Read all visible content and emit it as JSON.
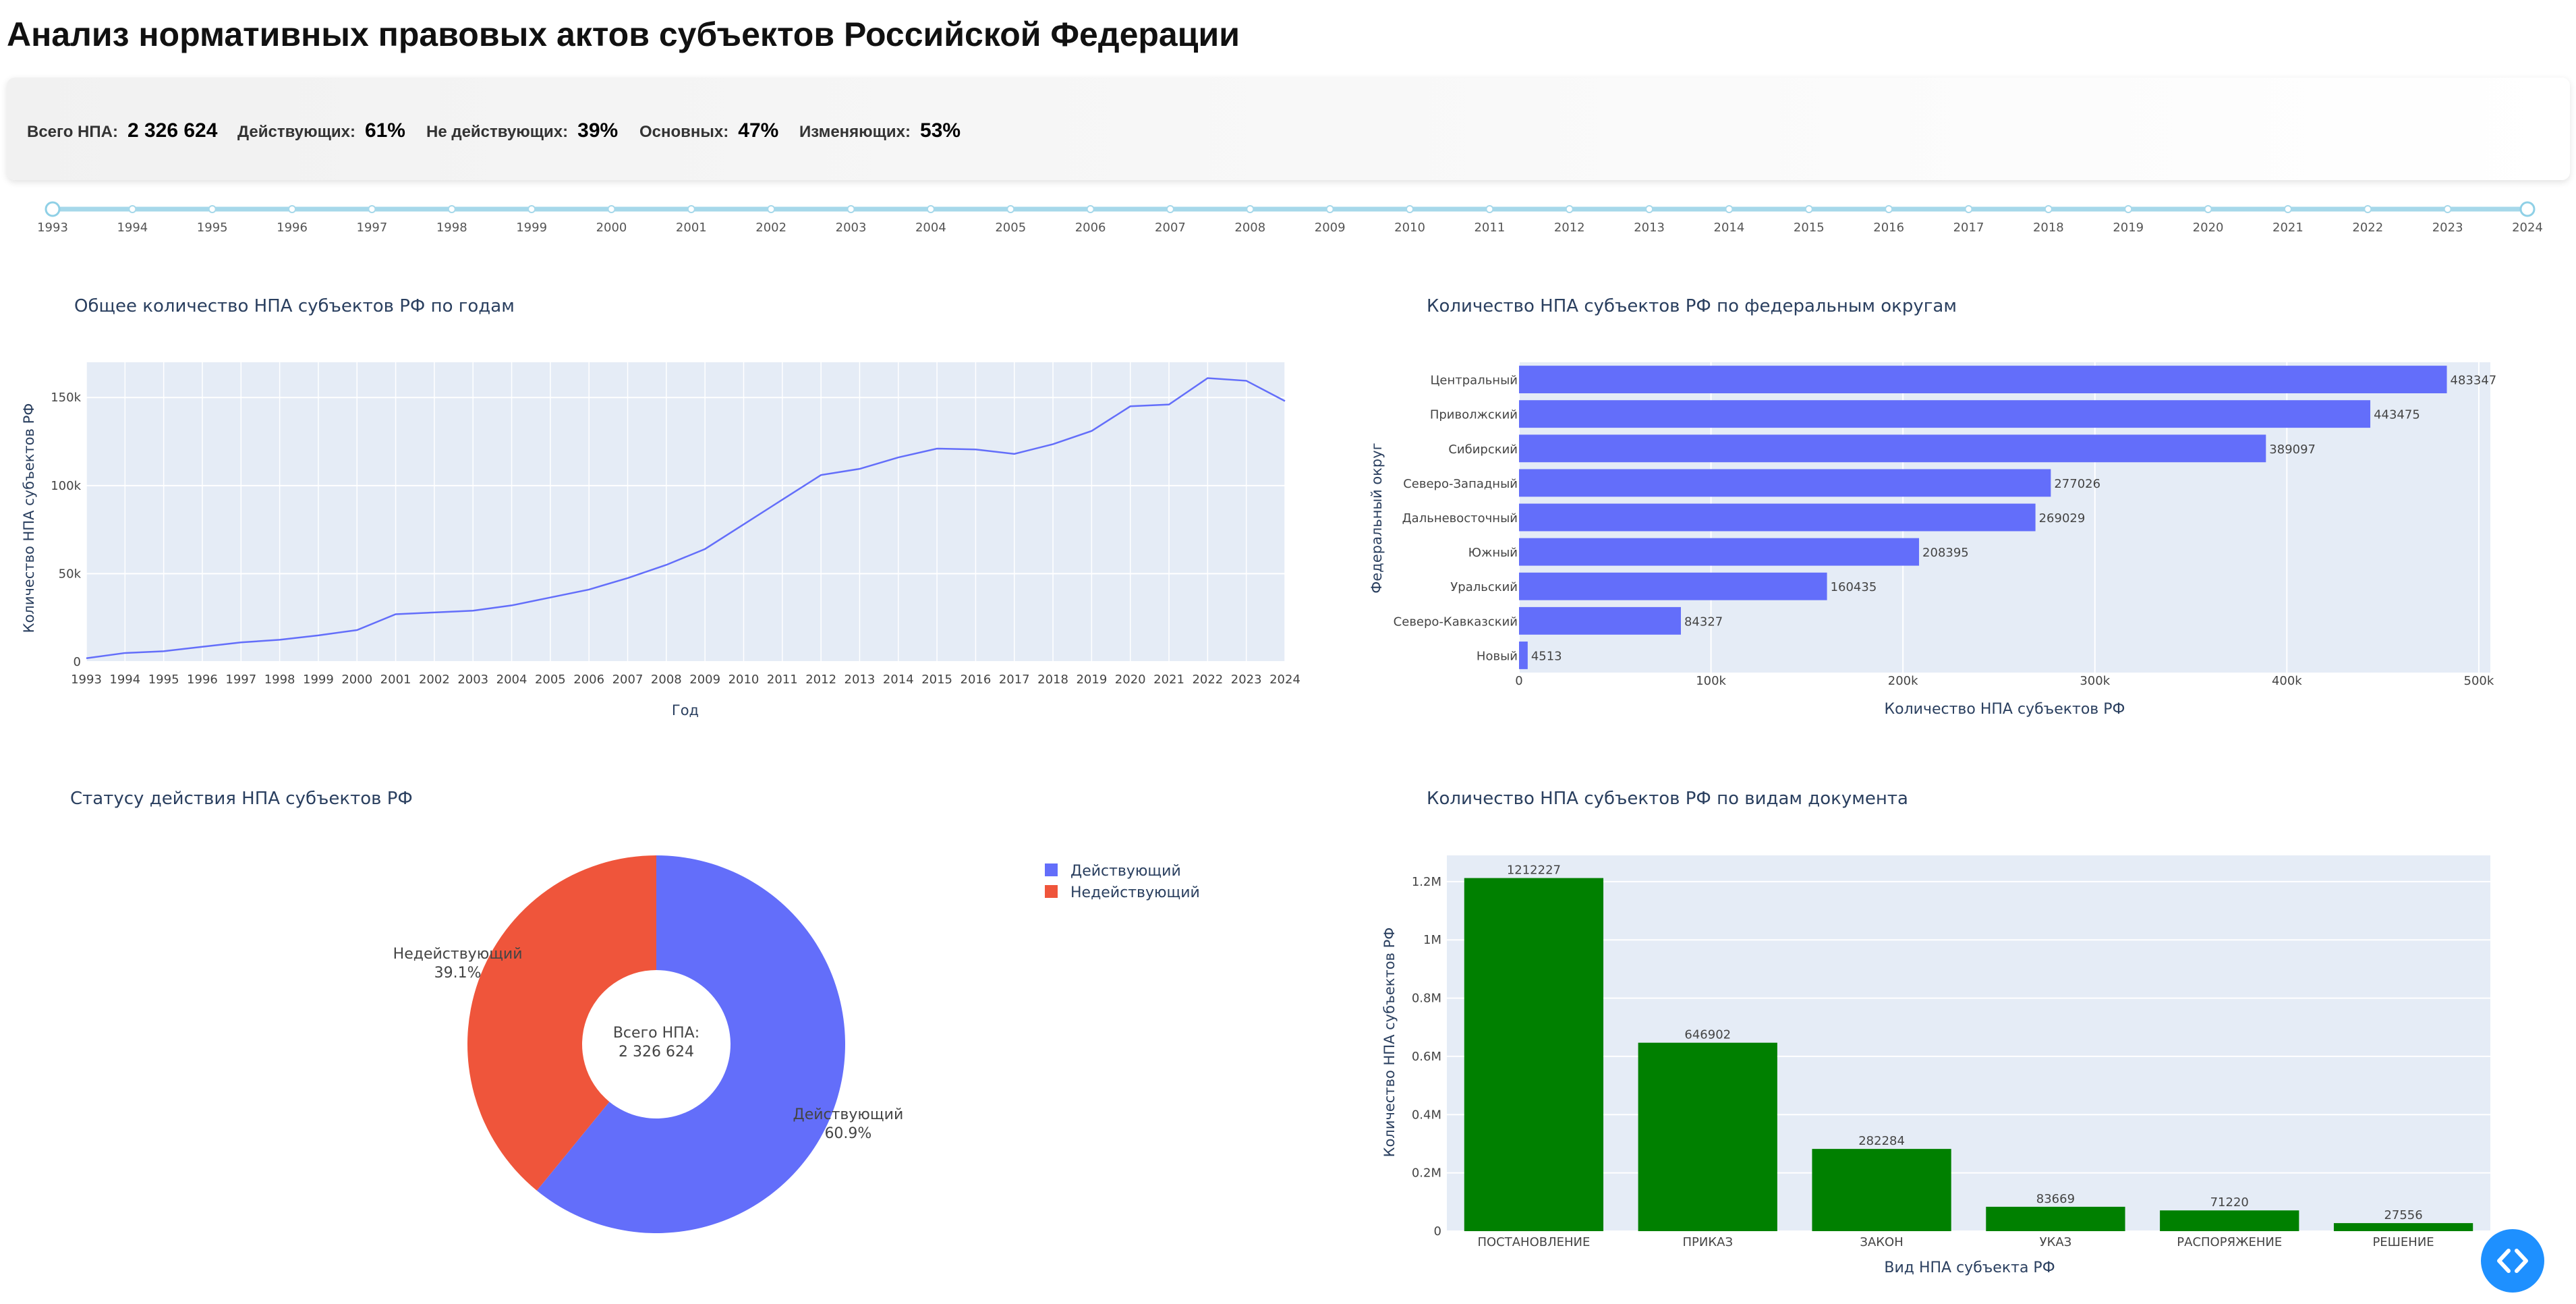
{
  "page": {
    "title": "Анализ нормативных правовых актов субъектов Российской Федерации"
  },
  "kpis": [
    {
      "label": "Всего НПА:",
      "value": "2 326 624"
    },
    {
      "label": "Действующих:",
      "value": "61%"
    },
    {
      "label": "Не действующих:",
      "value": "39%"
    },
    {
      "label": "Основных:",
      "value": "47%"
    },
    {
      "label": "Изменяющих:",
      "value": "53%"
    }
  ],
  "slider": {
    "marks": [
      "1993",
      "1994",
      "1995",
      "1996",
      "1997",
      "1998",
      "1999",
      "2000",
      "2001",
      "2002",
      "2003",
      "2004",
      "2005",
      "2006",
      "2007",
      "2008",
      "2009",
      "2010",
      "2011",
      "2012",
      "2013",
      "2014",
      "2015",
      "2016",
      "2017",
      "2018",
      "2019",
      "2020",
      "2021",
      "2022",
      "2023",
      "2024"
    ],
    "range": [
      1993,
      2024
    ],
    "color": "#a6d8ea"
  },
  "chart_data": [
    {
      "type": "line",
      "title": "Общее количество НПА субъектов РФ по годам",
      "xlabel": "Год",
      "ylabel": "Количество НПА субъектов РФ",
      "x": [
        "1993",
        "1994",
        "1995",
        "1996",
        "1997",
        "1998",
        "1999",
        "2000",
        "2001",
        "2002",
        "2003",
        "2004",
        "2005",
        "2006",
        "2007",
        "2008",
        "2009",
        "2010",
        "2011",
        "2012",
        "2013",
        "2014",
        "2015",
        "2016",
        "2017",
        "2018",
        "2019",
        "2020",
        "2021",
        "2022",
        "2023",
        "2024"
      ],
      "values": [
        2000,
        5000,
        6000,
        8500,
        11000,
        12500,
        15000,
        18000,
        27000,
        28000,
        29000,
        32000,
        36500,
        41000,
        47500,
        55000,
        64000,
        78000,
        92000,
        106000,
        109500,
        116000,
        121000,
        120500,
        118000,
        123500,
        131000,
        145000,
        146000,
        161000,
        159500,
        148000
      ],
      "ylim": [
        0,
        170000
      ],
      "yticks": [
        {
          "v": 0,
          "t": "0"
        },
        {
          "v": 50000,
          "t": "50k"
        },
        {
          "v": 100000,
          "t": "100k"
        },
        {
          "v": 150000,
          "t": "150k"
        }
      ],
      "color": "#636efa",
      "grid": true
    },
    {
      "type": "bar",
      "orientation": "horizontal",
      "title": "Количество НПА субъектов РФ по федеральным округам",
      "xlabel": "Количество НПА субъектов РФ",
      "ylabel": "Федеральный округ",
      "categories": [
        "Центральный",
        "Приволжский",
        "Сибирский",
        "Северо-Западный",
        "Дальневосточный",
        "Южный",
        "Уральский",
        "Северо-Кавказский",
        "Новый"
      ],
      "values": [
        483347,
        443475,
        389097,
        277026,
        269029,
        208395,
        160435,
        84327,
        4513
      ],
      "xlim": [
        0,
        506000
      ],
      "xticks": [
        {
          "v": 0,
          "t": "0"
        },
        {
          "v": 100000,
          "t": "100k"
        },
        {
          "v": 200000,
          "t": "200k"
        },
        {
          "v": 300000,
          "t": "300k"
        },
        {
          "v": 400000,
          "t": "400k"
        },
        {
          "v": 500000,
          "t": "500k"
        }
      ],
      "color": "#636efa",
      "grid": true
    },
    {
      "type": "pie",
      "title": "Статусу действия НПА субъектов РФ",
      "center_text": [
        "Всего НПА:",
        "2 326 624"
      ],
      "labels": [
        "Действующий",
        "Недействующий"
      ],
      "values": [
        60.9,
        39.1
      ],
      "percent_labels": [
        "60.9%",
        "39.1%"
      ],
      "colors": [
        "#636efa",
        "#ef553b"
      ],
      "legend": "top-right"
    },
    {
      "type": "bar",
      "title": "Количество НПА субъектов РФ по видам документа",
      "xlabel": "Вид НПА субъекта РФ",
      "ylabel": "Количество НПА субъектов РФ",
      "categories": [
        "ПОСТАНОВЛЕНИЕ",
        "ПРИКАЗ",
        "ЗАКОН",
        "УКАЗ",
        "РАСПОРЯЖЕНИЕ",
        "РЕШЕНИЕ"
      ],
      "values": [
        1212227,
        646902,
        282284,
        83669,
        71220,
        27556
      ],
      "ylim": [
        0,
        1290000
      ],
      "yticks": [
        {
          "v": 0,
          "t": "0"
        },
        {
          "v": 200000,
          "t": "0.2M"
        },
        {
          "v": 400000,
          "t": "0.4M"
        },
        {
          "v": 600000,
          "t": "0.6M"
        },
        {
          "v": 800000,
          "t": "0.8M"
        },
        {
          "v": 1000000,
          "t": "1M"
        },
        {
          "v": 1200000,
          "t": "1.2M"
        }
      ],
      "color": "#008000",
      "grid": true
    }
  ],
  "fab": {
    "icon": "code-icon",
    "color": "#1e90ff"
  }
}
